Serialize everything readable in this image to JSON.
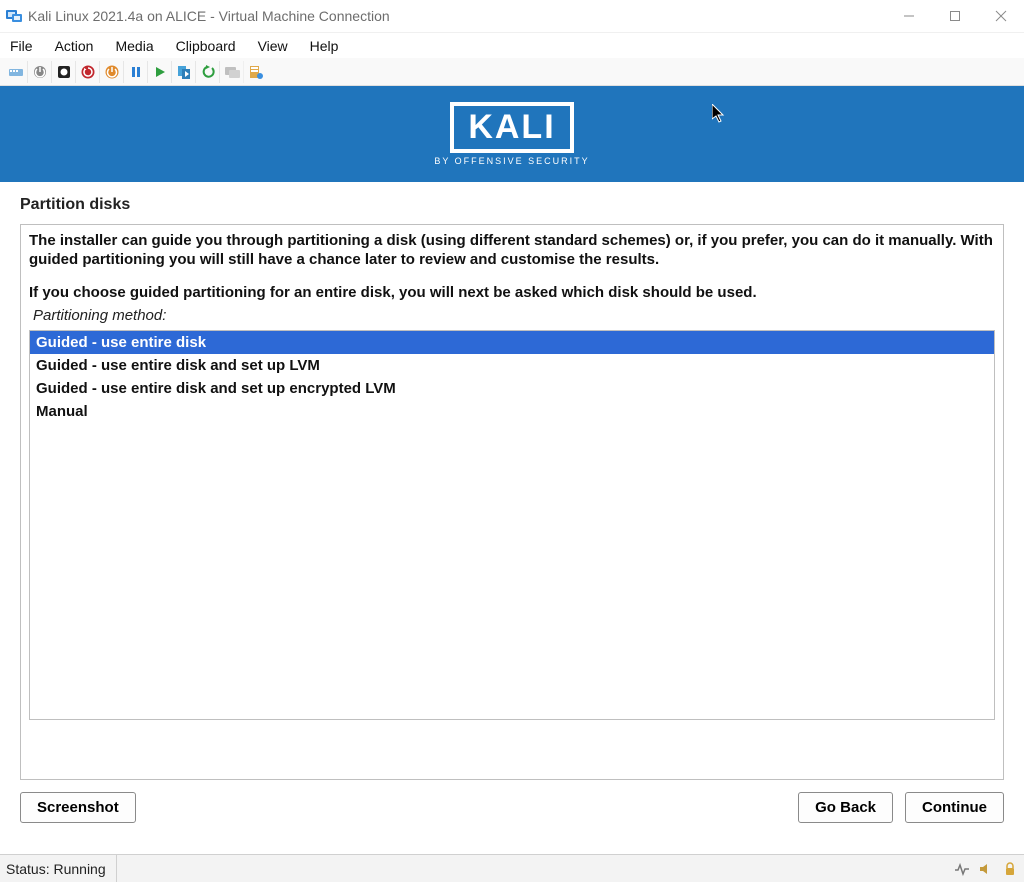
{
  "window": {
    "title": "Kali Linux 2021.4a on ALICE - Virtual Machine Connection"
  },
  "menubar": {
    "items": [
      "File",
      "Action",
      "Media",
      "Clipboard",
      "View",
      "Help"
    ]
  },
  "toolbar_icons": {
    "ctrlaltdel": "ctrl-alt-del-icon",
    "turnoff": "turnoff-icon",
    "shutdown": "shutdown-icon",
    "reset": "reset-icon",
    "save": "save-icon",
    "pause": "pause-icon",
    "start": "start-icon",
    "checkpoint": "checkpoint-icon",
    "revert": "revert-icon",
    "enhanced": "enhanced-session-icon",
    "share": "share-icon"
  },
  "kali": {
    "brand": "KALI",
    "tagline": "BY OFFENSIVE SECURITY"
  },
  "installer": {
    "step_title": "Partition disks",
    "description1": "The installer can guide you through partitioning a disk (using different standard schemes) or, if you prefer, you can do it manually. With guided partitioning you will still have a chance later to review and customise the results.",
    "description2": "If you choose guided partitioning for an entire disk, you will next be asked which disk should be used.",
    "method_label": "Partitioning method:",
    "options": [
      "Guided - use entire disk",
      "Guided - use entire disk and set up LVM",
      "Guided - use entire disk and set up encrypted LVM",
      "Manual"
    ],
    "selected_index": 0,
    "buttons": {
      "screenshot": "Screenshot",
      "go_back": "Go Back",
      "continue": "Continue"
    }
  },
  "status": {
    "text": "Status: Running"
  }
}
